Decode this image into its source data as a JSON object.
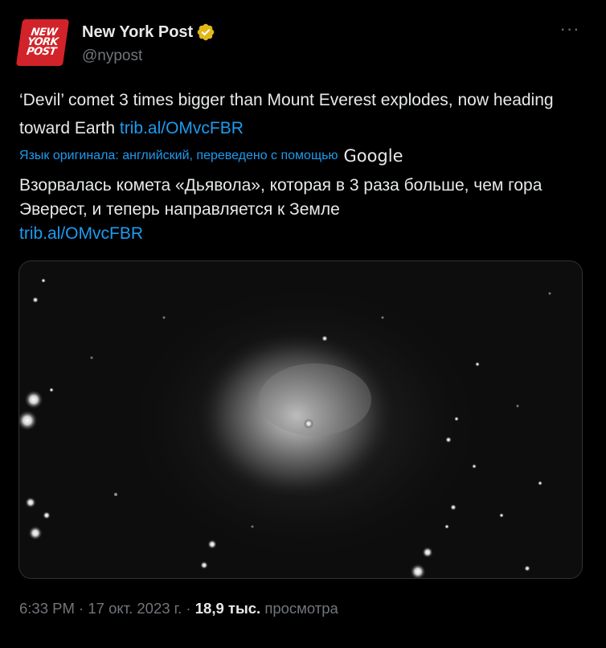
{
  "author": {
    "avatar_lines": [
      "NEW",
      "YORK",
      "POST"
    ],
    "display_name": "New York Post",
    "handle": "@nypost",
    "verified_icon": "gold-verified-badge-icon",
    "more_label": "···"
  },
  "tweet": {
    "text": "‘Devil’ comet 3 times bigger than Mount Everest explodes, now heading toward Earth ",
    "link": "trib.al/OMvcFBR"
  },
  "translation": {
    "note": "Язык оригинала: английский, переведено с помощью",
    "provider": "Google",
    "text": "Взорвалась комета «Дьявола», которая в 3 раза больше, чем гора Эверест, и теперь направляется к Земле",
    "link": "trib.al/OMvcFBR"
  },
  "media": {
    "description_icon": "comet-photo"
  },
  "meta": {
    "time": "6:33 PM",
    "separator": " · ",
    "date": "17 окт. 2023 г.",
    "views_count": "18,9 тыс.",
    "views_label": "просмотра"
  },
  "colors": {
    "link": "#1d9bf0",
    "muted": "#71767b",
    "text": "#e7e9ea",
    "background": "#000000",
    "avatar": "#d2232a"
  }
}
